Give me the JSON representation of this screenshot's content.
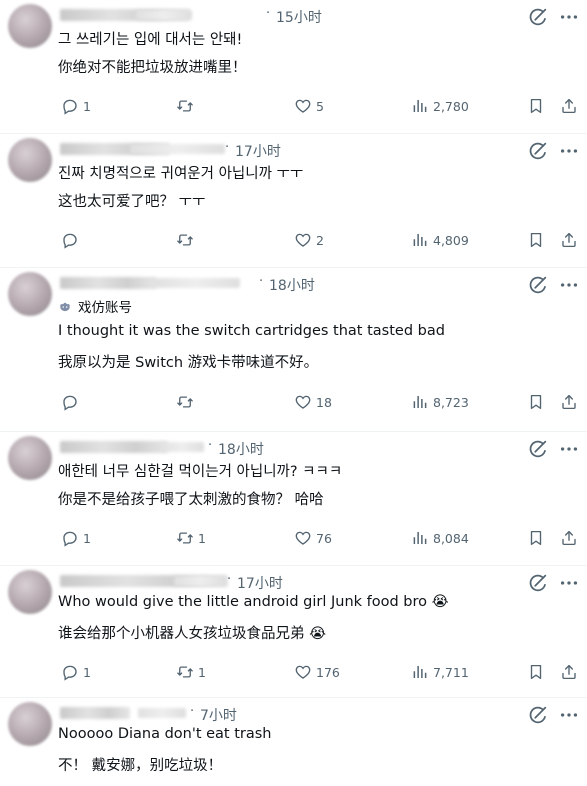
{
  "replies": [
    {
      "time": "15小时",
      "line1": "그 쓰레기는 입에 대서는 안돼!",
      "line2": "你绝对不能把垃圾放进嘴里！",
      "badge": "",
      "replies": "1",
      "reposts": "",
      "likes": "5",
      "views": "2,780"
    },
    {
      "time": "17小时",
      "line1": "진짜 치명적으로 귀여운거 아닙니까 ㅜㅜ",
      "line2": "这也太可爱了吧？ ㅜㅜ",
      "badge": "",
      "replies": "",
      "reposts": "",
      "likes": "2",
      "views": "4,809"
    },
    {
      "time": "18小时",
      "line1": "I thought it was the switch cartridges that tasted bad",
      "line2": "我原以为是 Switch 游戏卡带味道不好。",
      "badge": "戏仿账号",
      "replies": "",
      "reposts": "",
      "likes": "18",
      "views": "8,723"
    },
    {
      "time": "18小时",
      "line1": "애한테 너무 심한걸 먹이는거 아닙니까? ㅋㅋㅋ",
      "line2": "你是不是给孩子喂了太刺激的食物？ 哈哈",
      "badge": "",
      "replies": "1",
      "reposts": "1",
      "likes": "76",
      "views": "8,084"
    },
    {
      "time": "17小时",
      "line1": "Who would give the little android girl Junk food bro 😭",
      "line2": "谁会给那个小机器人女孩垃圾食品兄弟 😭",
      "badge": "",
      "replies": "1",
      "reposts": "1",
      "likes": "176",
      "views": "7,711"
    },
    {
      "time": "7小时",
      "line1": "Nooooo Diana don't eat trash",
      "line2": "不！ 戴安娜，别吃垃圾！",
      "badge": "",
      "replies": "",
      "reposts": "",
      "likes": "",
      "views": ""
    }
  ],
  "icons": {
    "reply": "reply-icon",
    "repost": "repost-icon",
    "like": "heart-icon",
    "views": "views-icon",
    "bookmark": "bookmark-icon",
    "share": "share-icon",
    "grok": "grok-icon",
    "more": "more-icon"
  },
  "colors": {
    "text": "#0f1419",
    "muted": "#536471",
    "divider": "#eff3f4"
  }
}
